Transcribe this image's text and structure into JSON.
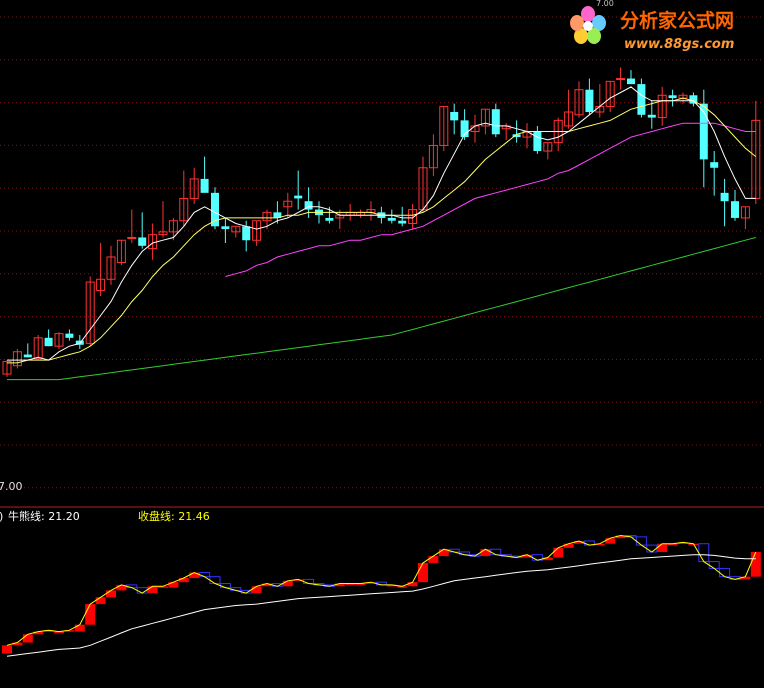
{
  "watermark": {
    "brand": "分析家公式网",
    "site": "www.88gs.com"
  },
  "colors": {
    "background": "#000000",
    "grid": "#7a1a1a",
    "up": "#ff3232",
    "down": "#54ffff",
    "ma_short": "#ffffff",
    "ma_mid": "#ffff66",
    "ma_purple": "#ff44ff",
    "ma_long": "#33cc33",
    "bull_up": "#ff0000",
    "bull_down": "#3333ff",
    "label_white": "#ffffff",
    "label_yellow": "#ffff00"
  },
  "main_panel": {
    "axis_label": "7.00",
    "top_label": "7.00"
  },
  "sub_panel": {
    "prefix": ")",
    "bull_line_label": "牛熊线: 21.20",
    "close_line_label": "收盘线: 21.46"
  },
  "chart_data": {
    "type": "candlestick",
    "note_axis": "price",
    "candles": [
      [
        18.0,
        18.5,
        17.9,
        18.45
      ],
      [
        18.3,
        18.9,
        18.2,
        18.8
      ],
      [
        18.7,
        19.1,
        18.6,
        18.6
      ],
      [
        18.55,
        19.4,
        18.5,
        19.3
      ],
      [
        19.3,
        19.6,
        19.0,
        19.0
      ],
      [
        19.0,
        19.5,
        18.9,
        19.45
      ],
      [
        19.45,
        19.6,
        19.2,
        19.3
      ],
      [
        19.2,
        19.4,
        18.9,
        19.05
      ],
      [
        19.1,
        21.5,
        19.0,
        21.3
      ],
      [
        21.0,
        22.7,
        20.8,
        21.4
      ],
      [
        21.4,
        22.6,
        21.2,
        22.2
      ],
      [
        22.0,
        22.8,
        21.9,
        22.8
      ],
      [
        22.9,
        23.9,
        22.7,
        22.9
      ],
      [
        22.9,
        23.8,
        22.5,
        22.6
      ],
      [
        22.5,
        23.4,
        22.1,
        23.0
      ],
      [
        23.0,
        24.2,
        22.9,
        23.1
      ],
      [
        23.1,
        23.6,
        22.8,
        23.5
      ],
      [
        23.5,
        25.3,
        23.3,
        24.3
      ],
      [
        24.3,
        25.4,
        24.1,
        25.0
      ],
      [
        25.0,
        25.8,
        24.6,
        24.5
      ],
      [
        24.5,
        24.7,
        23.2,
        23.3
      ],
      [
        23.3,
        23.6,
        22.7,
        23.2
      ],
      [
        23.1,
        23.3,
        22.9,
        23.3
      ],
      [
        23.3,
        23.5,
        22.4,
        22.8
      ],
      [
        22.8,
        23.5,
        22.6,
        23.5
      ],
      [
        23.5,
        23.9,
        23.2,
        23.8
      ],
      [
        23.8,
        24.2,
        23.4,
        23.6
      ],
      [
        24.0,
        24.5,
        23.6,
        24.2
      ],
      [
        24.4,
        25.3,
        23.9,
        24.3
      ],
      [
        24.2,
        24.7,
        23.6,
        23.9
      ],
      [
        23.9,
        24.2,
        23.4,
        23.7
      ],
      [
        23.6,
        24.0,
        23.4,
        23.5
      ],
      [
        23.6,
        23.9,
        23.2,
        23.7
      ],
      [
        23.7,
        24.1,
        23.5,
        23.8
      ],
      [
        23.7,
        23.9,
        23.6,
        23.8
      ],
      [
        23.8,
        24.2,
        23.5,
        23.9
      ],
      [
        23.8,
        24.0,
        23.4,
        23.6
      ],
      [
        23.6,
        23.9,
        23.4,
        23.5
      ],
      [
        23.5,
        24.0,
        23.3,
        23.4
      ],
      [
        23.4,
        24.1,
        23.2,
        23.9
      ],
      [
        23.9,
        25.8,
        23.8,
        25.4
      ],
      [
        25.4,
        26.6,
        25.1,
        26.2
      ],
      [
        26.2,
        27.6,
        26.0,
        27.6
      ],
      [
        27.4,
        27.7,
        26.6,
        27.1
      ],
      [
        27.1,
        27.5,
        26.4,
        26.5
      ],
      [
        26.7,
        27.3,
        26.3,
        26.9
      ],
      [
        26.9,
        27.5,
        26.6,
        27.5
      ],
      [
        27.5,
        27.7,
        26.5,
        26.6
      ],
      [
        26.8,
        27.0,
        26.4,
        26.9
      ],
      [
        26.6,
        27.1,
        26.3,
        26.5
      ],
      [
        26.5,
        27.0,
        26.1,
        26.7
      ],
      [
        26.7,
        26.9,
        25.9,
        26.0
      ],
      [
        26.0,
        26.3,
        25.7,
        26.3
      ],
      [
        26.3,
        27.2,
        26.0,
        27.1
      ],
      [
        26.9,
        28.2,
        26.8,
        27.4
      ],
      [
        27.3,
        28.5,
        27.2,
        28.2
      ],
      [
        28.2,
        28.6,
        27.3,
        27.4
      ],
      [
        27.4,
        28.4,
        27.2,
        27.6
      ],
      [
        27.6,
        28.5,
        27.4,
        28.5
      ],
      [
        28.6,
        29.0,
        28.2,
        28.6
      ],
      [
        28.6,
        28.9,
        28.4,
        28.4
      ],
      [
        28.4,
        28.6,
        27.2,
        27.3
      ],
      [
        27.3,
        27.8,
        26.8,
        27.2
      ],
      [
        27.2,
        28.3,
        26.9,
        28.0
      ],
      [
        28.0,
        28.2,
        27.6,
        27.9
      ],
      [
        27.9,
        28.1,
        27.7,
        28.0
      ],
      [
        28.0,
        28.1,
        27.6,
        27.7
      ],
      [
        27.7,
        28.2,
        24.7,
        25.7
      ],
      [
        25.6,
        26.0,
        24.4,
        25.4
      ],
      [
        24.5,
        25.0,
        23.3,
        24.2
      ],
      [
        24.2,
        24.6,
        23.5,
        23.6
      ],
      [
        23.6,
        24.0,
        23.2,
        24.0
      ],
      [
        24.3,
        27.8,
        24.1,
        27.1
      ]
    ],
    "ma_short": [
      18.5,
      18.5,
      18.5,
      18.6,
      18.5,
      18.8,
      19.0,
      19.1,
      19.6,
      20.1,
      20.6,
      21.3,
      21.9,
      22.4,
      22.7,
      22.8,
      22.9,
      23.3,
      23.8,
      24.0,
      23.8,
      23.6,
      23.4,
      23.3,
      23.2,
      23.3,
      23.5,
      23.6,
      23.8,
      24.0,
      24.0,
      23.9,
      23.7,
      23.7,
      23.7,
      23.7,
      23.7,
      23.7,
      23.6,
      23.6,
      23.9,
      24.4,
      25.2,
      25.9,
      26.6,
      26.9,
      27.0,
      26.9,
      26.9,
      26.8,
      26.7,
      26.5,
      26.4,
      26.5,
      26.7,
      27.0,
      27.3,
      27.6,
      27.9,
      28.1,
      28.3,
      28.0,
      27.8,
      27.8,
      27.8,
      27.8,
      27.8,
      27.4,
      26.7,
      25.8,
      25.0,
      24.3,
      24.3
    ],
    "ma_mid": [
      18.4,
      18.4,
      18.5,
      18.5,
      18.5,
      18.6,
      18.7,
      18.8,
      19.0,
      19.3,
      19.7,
      20.1,
      20.6,
      21.0,
      21.5,
      21.9,
      22.2,
      22.6,
      23.0,
      23.3,
      23.5,
      23.6,
      23.6,
      23.6,
      23.6,
      23.6,
      23.6,
      23.7,
      23.7,
      23.8,
      23.8,
      23.8,
      23.8,
      23.8,
      23.8,
      23.8,
      23.7,
      23.7,
      23.7,
      23.7,
      23.8,
      24.0,
      24.3,
      24.6,
      24.9,
      25.3,
      25.7,
      26.0,
      26.3,
      26.6,
      26.7,
      26.7,
      26.7,
      26.7,
      26.7,
      26.8,
      26.9,
      27.0,
      27.1,
      27.3,
      27.5,
      27.6,
      27.7,
      27.8,
      27.8,
      27.9,
      27.8,
      27.6,
      27.3,
      26.9,
      26.5,
      26.1,
      25.8
    ],
    "ma_purple": [
      null,
      null,
      null,
      null,
      null,
      null,
      null,
      null,
      null,
      null,
      null,
      null,
      null,
      null,
      null,
      null,
      null,
      null,
      null,
      null,
      null,
      21.5,
      21.6,
      21.7,
      21.9,
      22.0,
      22.2,
      22.3,
      22.4,
      22.5,
      22.6,
      22.6,
      22.7,
      22.8,
      22.8,
      22.9,
      23.0,
      23.0,
      23.1,
      23.2,
      23.3,
      23.5,
      23.7,
      23.9,
      24.1,
      24.3,
      24.4,
      24.5,
      24.6,
      24.7,
      24.8,
      24.9,
      25.0,
      25.2,
      25.3,
      25.5,
      25.7,
      25.9,
      26.1,
      26.3,
      26.5,
      26.6,
      26.7,
      26.8,
      26.9,
      27.0,
      27.0,
      27.0,
      27.0,
      26.9,
      26.8,
      26.7,
      26.7
    ],
    "ma_long": [
      17.8,
      17.8,
      17.8,
      17.8,
      17.8,
      17.8,
      17.85,
      17.9,
      17.95,
      18.0,
      18.05,
      18.1,
      18.15,
      18.2,
      18.25,
      18.3,
      18.35,
      18.4,
      18.45,
      18.5,
      18.55,
      18.6,
      18.65,
      18.7,
      18.75,
      18.8,
      18.85,
      18.9,
      18.95,
      19.0,
      19.05,
      19.1,
      19.15,
      19.2,
      19.25,
      19.3,
      19.35,
      19.4,
      19.5,
      19.6,
      19.7,
      19.8,
      19.9,
      20.0,
      20.1,
      20.2,
      20.3,
      20.4,
      20.5,
      20.6,
      20.7,
      20.8,
      20.9,
      21.0,
      21.1,
      21.2,
      21.3,
      21.4,
      21.5,
      21.6,
      21.7,
      21.8,
      21.9,
      22.0,
      22.1,
      22.2,
      22.3,
      22.4,
      22.5,
      22.6,
      22.7,
      22.8,
      22.9
    ],
    "sub_bars": [
      [
        19.0,
        19.6
      ],
      [
        19.6,
        19.8
      ],
      [
        19.8,
        20.4
      ],
      [
        20.4,
        20.6
      ],
      [
        20.6,
        20.7
      ],
      [
        20.6,
        20.6
      ],
      [
        20.7,
        20.7
      ],
      [
        20.6,
        21.1
      ],
      [
        21.1,
        22.6
      ],
      [
        22.6,
        23.1
      ],
      [
        23.1,
        23.6
      ],
      [
        23.6,
        24.0
      ],
      [
        24.0,
        23.8
      ],
      [
        23.8,
        23.4
      ],
      [
        23.4,
        23.9
      ],
      [
        23.9,
        23.9
      ],
      [
        23.8,
        24.2
      ],
      [
        24.2,
        24.5
      ],
      [
        24.5,
        24.9
      ],
      [
        24.9,
        24.6
      ],
      [
        24.6,
        24.1
      ],
      [
        24.1,
        23.8
      ],
      [
        23.8,
        23.6
      ],
      [
        23.6,
        23.4
      ],
      [
        23.4,
        23.9
      ],
      [
        23.9,
        24.1
      ],
      [
        24.1,
        23.9
      ],
      [
        23.9,
        24.3
      ],
      [
        24.3,
        24.4
      ],
      [
        24.4,
        24.1
      ],
      [
        24.1,
        24.0
      ],
      [
        24.0,
        23.9
      ],
      [
        23.9,
        24.1
      ],
      [
        24.1,
        24.1
      ],
      [
        24.0,
        24.1
      ],
      [
        24.1,
        24.2
      ],
      [
        24.2,
        24.0
      ],
      [
        24.0,
        24.0
      ],
      [
        23.9,
        23.9
      ],
      [
        23.9,
        24.2
      ],
      [
        24.2,
        25.6
      ],
      [
        25.6,
        26.1
      ],
      [
        26.1,
        26.6
      ],
      [
        26.6,
        26.4
      ],
      [
        26.4,
        26.2
      ],
      [
        26.2,
        26.1
      ],
      [
        26.1,
        26.6
      ],
      [
        26.6,
        26.2
      ],
      [
        26.2,
        26.1
      ],
      [
        26.1,
        26.0
      ],
      [
        26.0,
        26.2
      ],
      [
        26.2,
        25.8
      ],
      [
        25.8,
        26.0
      ],
      [
        26.0,
        26.7
      ],
      [
        26.7,
        27.0
      ],
      [
        27.0,
        27.2
      ],
      [
        27.2,
        26.9
      ],
      [
        26.9,
        27.0
      ],
      [
        27.0,
        27.4
      ],
      [
        27.4,
        27.6
      ],
      [
        27.6,
        27.5
      ],
      [
        27.5,
        26.9
      ],
      [
        26.9,
        26.4
      ],
      [
        26.4,
        27.0
      ],
      [
        27.0,
        27.0
      ],
      [
        27.0,
        27.1
      ],
      [
        27.0,
        27.0
      ],
      [
        27.0,
        25.7
      ],
      [
        25.7,
        25.2
      ],
      [
        25.2,
        24.6
      ],
      [
        24.6,
        24.4
      ],
      [
        24.4,
        24.6
      ],
      [
        24.6,
        26.4
      ]
    ],
    "bull_line": [
      18.8,
      18.9,
      19.0,
      19.1,
      19.2,
      19.3,
      19.35,
      19.4,
      19.6,
      19.9,
      20.2,
      20.5,
      20.8,
      21.0,
      21.2,
      21.4,
      21.6,
      21.8,
      22.0,
      22.2,
      22.3,
      22.4,
      22.5,
      22.55,
      22.6,
      22.7,
      22.8,
      22.9,
      23.0,
      23.05,
      23.1,
      23.15,
      23.2,
      23.25,
      23.3,
      23.35,
      23.4,
      23.45,
      23.5,
      23.55,
      23.7,
      23.9,
      24.1,
      24.3,
      24.4,
      24.5,
      24.6,
      24.7,
      24.8,
      24.9,
      25.0,
      25.05,
      25.1,
      25.2,
      25.3,
      25.4,
      25.5,
      25.6,
      25.7,
      25.8,
      25.9,
      25.95,
      26.0,
      26.05,
      26.1,
      26.15,
      26.2,
      26.2,
      26.15,
      26.05,
      25.95,
      25.9,
      25.9
    ],
    "main_ylim": [
      14.2,
      30.7
    ],
    "sub_ylim": [
      17.8,
      28.0
    ]
  }
}
